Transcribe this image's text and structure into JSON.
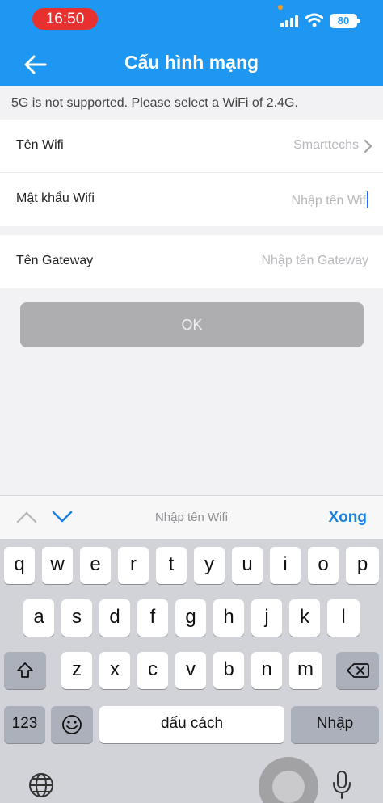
{
  "status": {
    "time": "16:50",
    "battery": "80"
  },
  "header": {
    "title": "Cấu hình mạng"
  },
  "notice": "5G is not supported. Please select a WiFi of  2.4G.",
  "form": {
    "wifi_name_label": "Tên Wifi",
    "wifi_name_value": "Smarttechs",
    "wifi_password_label": "Mật khẩu Wifi",
    "wifi_password_placeholder": "Nhập tên Wif",
    "gateway_label": "Tên Gateway",
    "gateway_placeholder": "Nhập tên Gateway"
  },
  "ok_button": "OK",
  "keyboard_bar": {
    "hint": "Nhập tên Wifi",
    "done": "Xong"
  },
  "keyboard": {
    "row1": [
      "q",
      "w",
      "e",
      "r",
      "t",
      "y",
      "u",
      "i",
      "o",
      "p"
    ],
    "row2": [
      "a",
      "s",
      "d",
      "f",
      "g",
      "h",
      "j",
      "k",
      "l"
    ],
    "row3": [
      "z",
      "x",
      "c",
      "v",
      "b",
      "n",
      "m"
    ],
    "numbers_key": "123",
    "space_key": "dấu cách",
    "return_key": "Nhập"
  },
  "colors": {
    "accent": "#1e97f2",
    "time_pill": "#e8312f",
    "done": "#1a7fe0"
  }
}
